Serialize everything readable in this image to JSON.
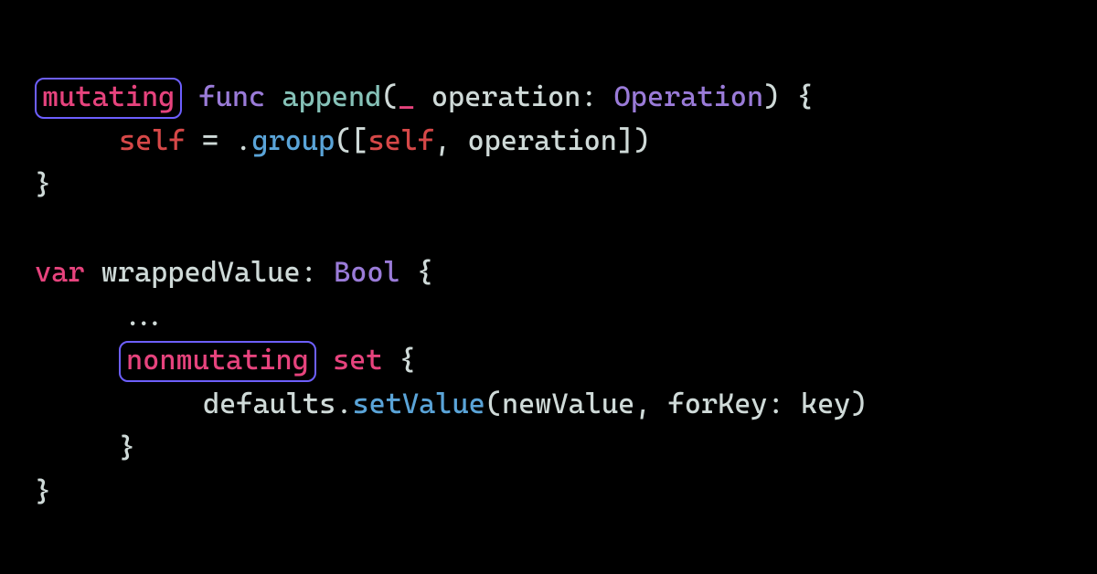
{
  "block1": {
    "mutating": "mutating",
    "func": "func",
    "append": "append",
    "lparen": "(",
    "underscore": "_",
    "param": "operation",
    "colon1": ":",
    "type": "Operation",
    "rparen_brace": ") {",
    "self1": "self",
    "eq": " = .",
    "group": "group",
    "lbr": "([",
    "self2": "self",
    "comma_sp": ", ",
    "operation2": "operation",
    "rbr": "])",
    "close": "}"
  },
  "block2": {
    "var": "var",
    "wrapped": "wrappedValue",
    "colon2": ":",
    "bool": "Bool",
    "brace": " {",
    "dots": "...",
    "nonmutating": "nonmutating",
    "set": "set",
    "brace2": " {",
    "defaults": "defaults",
    "dot": ".",
    "setValue": "setValue",
    "lparen2": "(",
    "newValue": "newValue",
    "comma2": ", ",
    "forKey": "forKey",
    "colon3": ":",
    "key": "key",
    "rparen2": ")",
    "close_inner": "}",
    "close_outer": "}"
  }
}
